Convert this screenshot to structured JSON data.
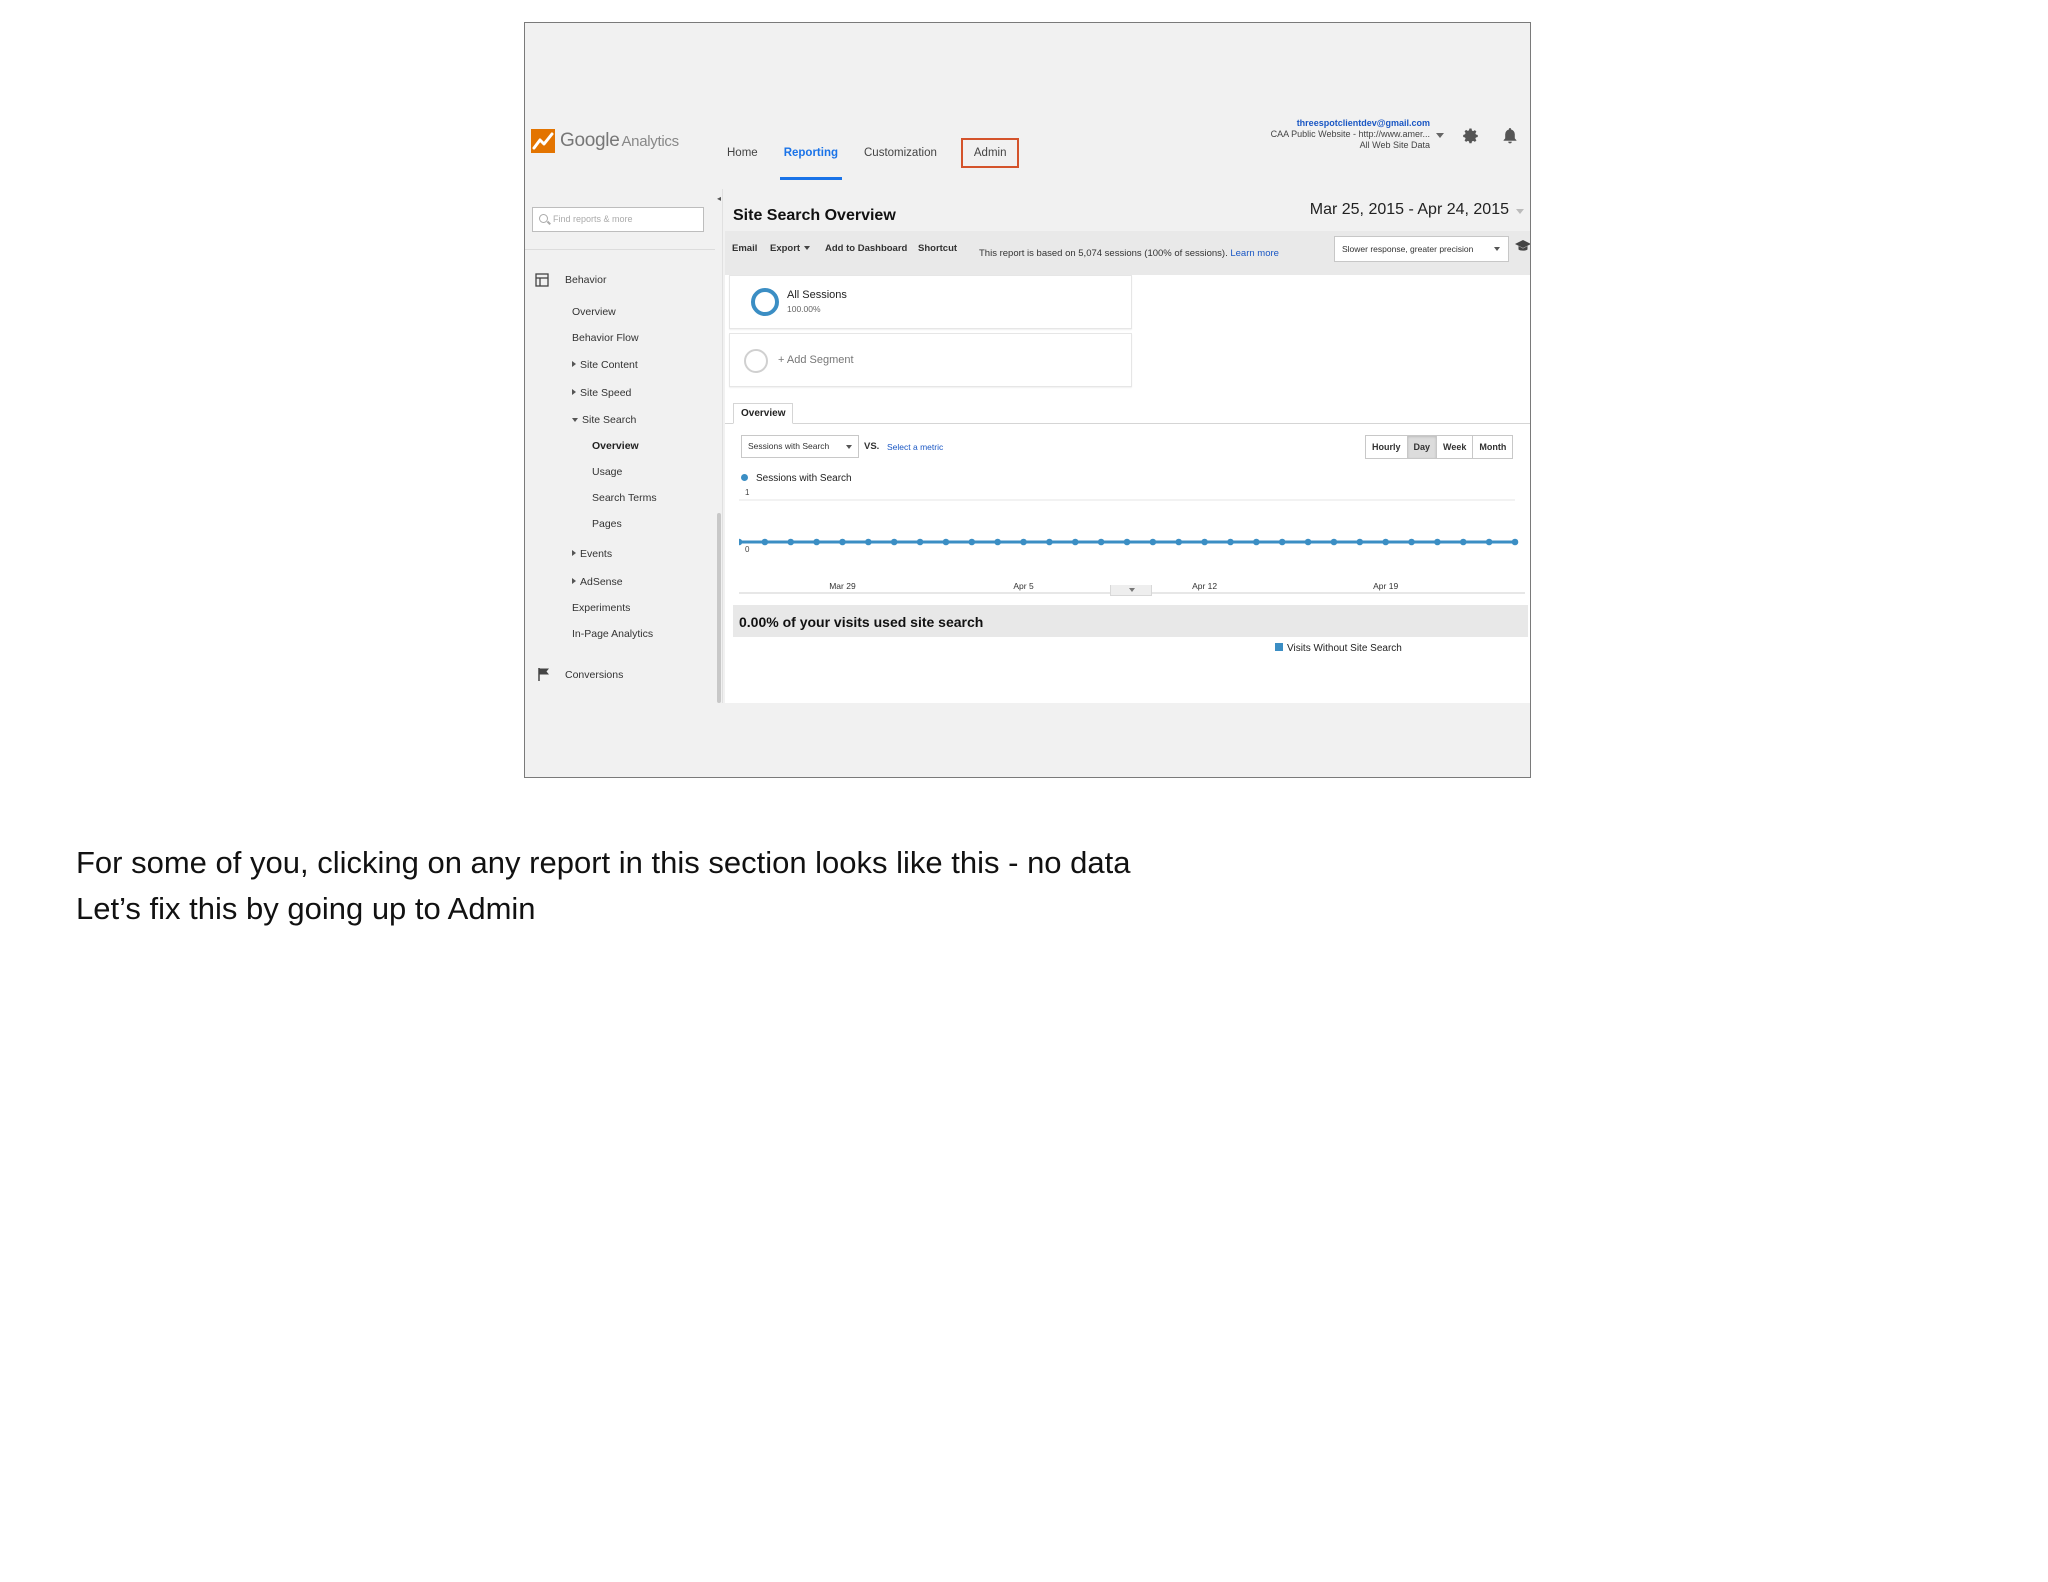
{
  "app": {
    "logo_brand": "Google",
    "logo_product": "Analytics"
  },
  "nav": {
    "home": "Home",
    "reporting": "Reporting",
    "customization": "Customization",
    "admin": "Admin"
  },
  "account": {
    "email": "threespotclientdev@gmail.com",
    "property": "CAA Public Website - http://www.amer...",
    "view": "All Web Site Data"
  },
  "icons": {
    "gear": "gear-icon",
    "bell": "bell-icon",
    "search": "search-icon",
    "behavior": "behavior-icon",
    "conversions": "flag-icon",
    "hat": "graduation-cap-icon"
  },
  "sidebar": {
    "search_placeholder": "Find reports & more",
    "behavior": "Behavior",
    "overview": "Overview",
    "behavior_flow": "Behavior Flow",
    "site_content": "Site Content",
    "site_speed": "Site Speed",
    "site_search": "Site Search",
    "ss_overview": "Overview",
    "ss_usage": "Usage",
    "ss_search_terms": "Search Terms",
    "ss_pages": "Pages",
    "events": "Events",
    "adsense": "AdSense",
    "experiments": "Experiments",
    "in_page_analytics": "In-Page Analytics",
    "conversions": "Conversions"
  },
  "report": {
    "title": "Site Search Overview",
    "date_range": "Mar 25, 2015 - Apr 24, 2015",
    "actions": {
      "email": "Email",
      "export": "Export",
      "add_to_dashboard": "Add to Dashboard",
      "shortcut": "Shortcut"
    },
    "note": "This report is based on 5,074 sessions (100% of sessions).",
    "note_link": "Learn more",
    "precision": "Slower response, greater precision",
    "segments": {
      "all_sessions": "All Sessions",
      "all_sessions_pct": "100.00%",
      "add_segment": "+ Add Segment"
    },
    "tab": "Overview",
    "metric": "Sessions with Search",
    "vs": "VS.",
    "select_metric": "Select a metric",
    "granularity": [
      "Hourly",
      "Day",
      "Week",
      "Month"
    ],
    "granularity_active": "Day",
    "legend": "Sessions with Search",
    "usage_text": "0.00% of your visits used site search",
    "pie_legend": "Visits Without Site Search"
  },
  "chart_data": {
    "type": "line",
    "series": [
      {
        "name": "Sessions with Search",
        "values": [
          0,
          0,
          0,
          0,
          0,
          0,
          0,
          0,
          0,
          0,
          0,
          0,
          0,
          0,
          0,
          0,
          0,
          0,
          0,
          0,
          0,
          0,
          0,
          0,
          0,
          0,
          0,
          0,
          0,
          0,
          0
        ]
      }
    ],
    "x_start": "Mar 25",
    "x_ticks": [
      "Mar 29",
      "Apr 5",
      "Apr 12",
      "Apr 19"
    ],
    "x_tick_index": [
      4,
      11,
      18,
      25
    ],
    "y_ticks": [
      "1",
      "0"
    ],
    "ylim": [
      0,
      1
    ],
    "color": "#3b8ec4",
    "grid": true
  },
  "caption": {
    "line1": "For some of you, clicking on any report in this section looks like this - no data",
    "line2": "Let’s fix this by going up to Admin"
  }
}
